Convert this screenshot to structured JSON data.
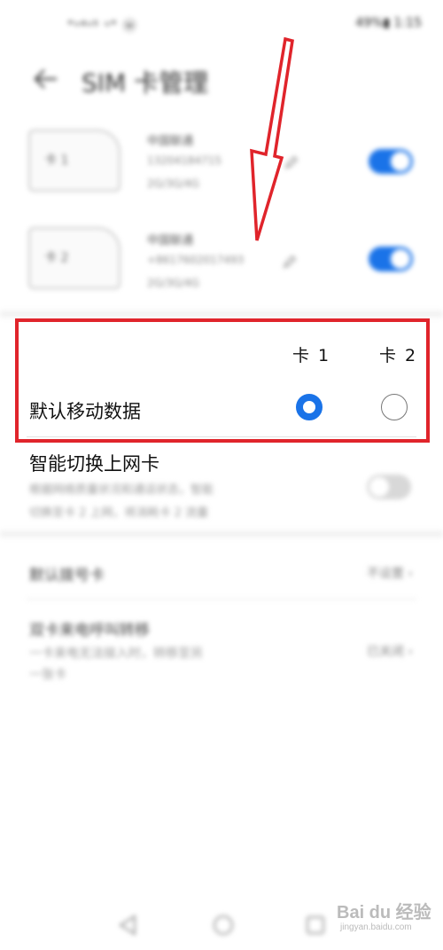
{
  "status_bar": {
    "left": "\"ᵘ⁴ᵘ⁵ ᵘ\" ⓦ",
    "right": "49%▮ 1:15"
  },
  "header": {
    "title": "SIM 卡管理"
  },
  "sims": [
    {
      "slot_label": "卡 1",
      "carrier": "中国联通",
      "number": "13204184715",
      "network": "2G/3G/4G"
    },
    {
      "slot_label": "卡 2",
      "carrier": "中国联通",
      "number": "+8617602017493",
      "network": "2G/3G/4G"
    }
  ],
  "data_panel": {
    "card1_header": "卡 1",
    "card2_header": "卡 2",
    "default_data_label": "默认移动数据"
  },
  "smart_switch": {
    "label": "智能切换上网卡",
    "desc_line1": "根据网络质量状况和通话状态，智能",
    "desc_line2": "切换至卡 2 上网，将消耗卡 2 流量"
  },
  "default_call": {
    "label": "默认拨号卡",
    "value": "不设置 ›"
  },
  "dual_card": {
    "label": "双卡来电呼叫转移",
    "desc_line1": "一卡来电无法接入时，转移至另",
    "desc_line2": "一张卡",
    "value": "已关闭 ›"
  },
  "watermark": {
    "text": "Bai du 经验",
    "sub": "jingyan.baidu.com"
  },
  "colors": {
    "accent": "#1a73e8",
    "annotation_red": "#e0242b"
  }
}
